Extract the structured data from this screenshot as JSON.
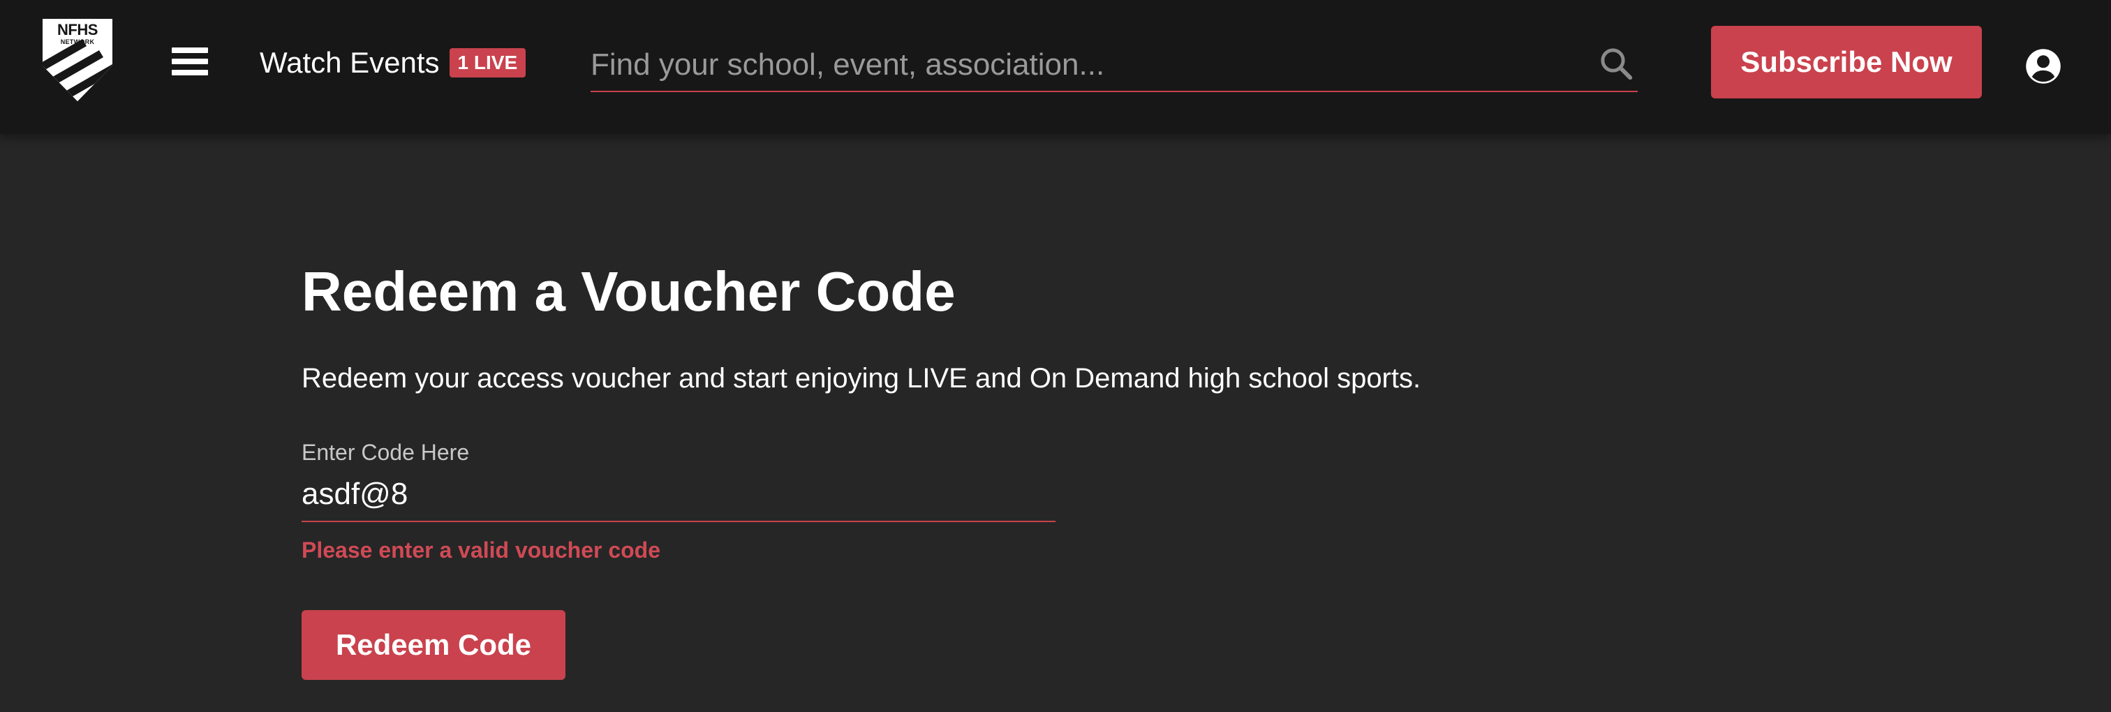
{
  "header": {
    "logo": {
      "icon": "nfhs-network-shield-logo",
      "line1": "NFHS",
      "line2": "NETWORK"
    },
    "menu_icon": "hamburger-menu-icon",
    "watch_events_label": "Watch Events",
    "live_badge": "1 LIVE",
    "search": {
      "placeholder": "Find your school, event, association...",
      "value": "",
      "icon": "search-icon"
    },
    "subscribe_label": "Subscribe Now",
    "account_icon": "account-circle-icon"
  },
  "main": {
    "title": "Redeem a Voucher Code",
    "description": "Redeem your access voucher and start enjoying LIVE and On Demand high school sports.",
    "code_field": {
      "label": "Enter Code Here",
      "value": "asdf@8"
    },
    "error": "Please enter a valid voucher code",
    "redeem_label": "Redeem Code"
  },
  "colors": {
    "background": "#262626",
    "header_background": "#171717",
    "accent": "#c9424d",
    "error_text": "#d04a55",
    "text": "#ffffff",
    "muted_text": "#c8c8c8",
    "placeholder": "#9a9a9a"
  }
}
